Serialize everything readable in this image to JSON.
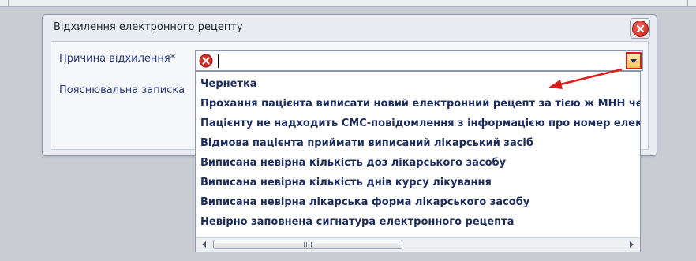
{
  "dialog": {
    "title": "Відхилення електронного рецепту",
    "close_icon": "close-icon"
  },
  "form": {
    "reason_label": "Причина відхилення*",
    "note_label": "Пояснювальна записка",
    "reason_value": "",
    "error_icon": "error-icon"
  },
  "dropdown": {
    "items": [
      "Чернетка",
      "Прохання пацієнта виписати новий електронний рецепт за тією ж МНН чер",
      "Пацієнту не надходить СМС-повідомлення з інформацією про номер електр",
      "Відмова пацієнта приймати  виписаний лікарський засіб",
      "Виписана невірна кількість доз лікарського засобу",
      "Виписана невірна кількість днів курсу лікування",
      "Виписана невірна лікарська форма лікарського засобу",
      "Невірно заповнена сигнатура електронного рецепта"
    ]
  },
  "colors": {
    "highlight": "#e11b1b",
    "label_text": "#2a3b7a",
    "item_text": "#1c2c5c"
  }
}
